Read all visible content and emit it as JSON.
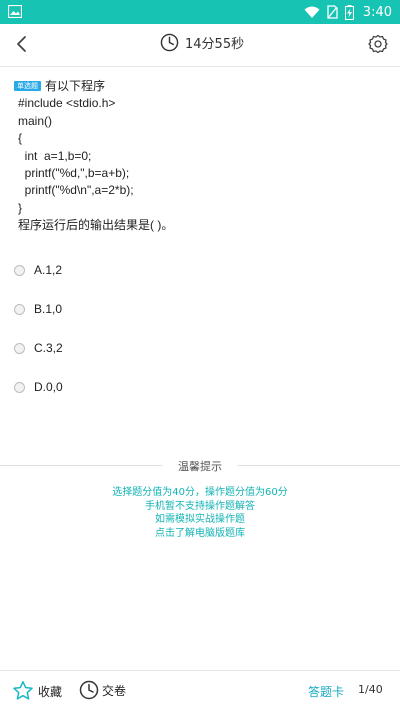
{
  "status_bar": {
    "time": "3:40"
  },
  "header": {
    "timer": "14分55秒"
  },
  "question": {
    "tag": "单选题",
    "title": "有以下程序",
    "code_lines": [
      "#include <stdio.h>",
      "main()",
      "{",
      "  int  a=1,b=0;",
      "  printf(\"%d,\",b=a+b);",
      "  printf(\"%d\\n\",a=2*b);",
      "}",
      "程序运行后的输出结果是( )。"
    ]
  },
  "options": [
    "A.1,2",
    "B.1,0",
    "C.3,2",
    "D.0,0"
  ],
  "tips": {
    "title": "温馨提示",
    "lines": [
      "选择题分值为40分，操作题分值为60分",
      "手机暂不支持操作题解答",
      "如需模拟实战操作题",
      "点击了解电脑版题库"
    ]
  },
  "bottom_bar": {
    "favorite_label": "收藏",
    "submit_label": "交卷",
    "answer_card_label": "答题卡",
    "page_indicator": "1/40"
  },
  "colors": {
    "accent": "#17c3b2",
    "tips_text": "#14b3b5",
    "answer_card": "#17a9c2",
    "tag_bg": "#2aa9e8"
  }
}
